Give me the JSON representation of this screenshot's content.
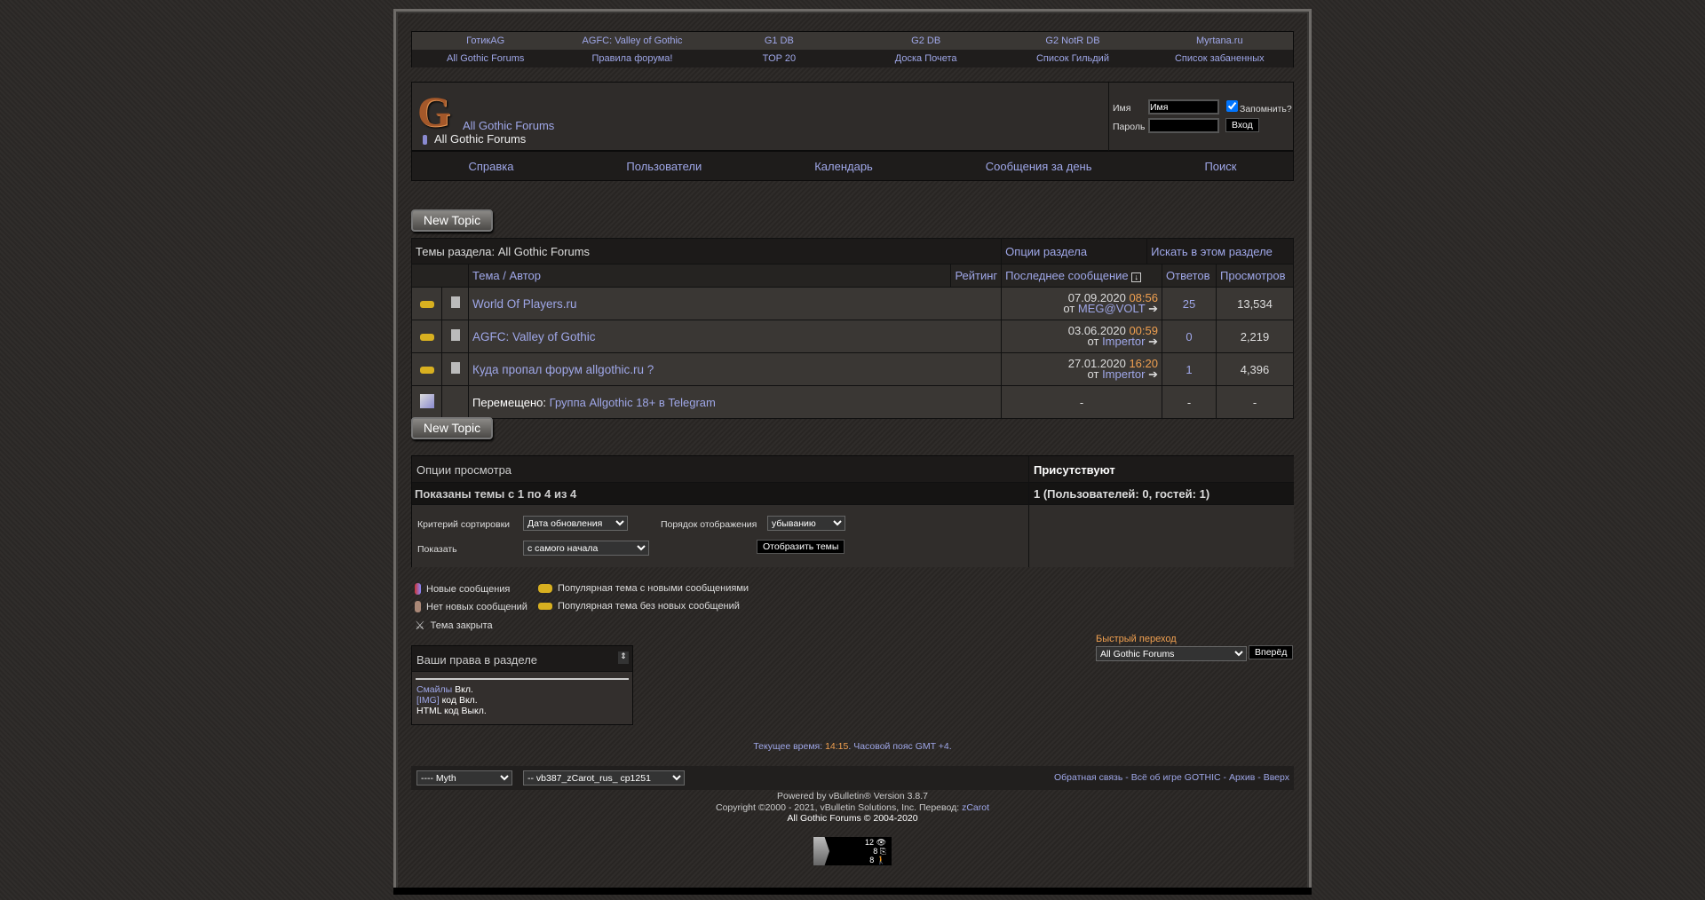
{
  "top_nav": {
    "row1": [
      "ГотикAG",
      "AGFC: Valley of Gothic",
      "G1 DB",
      "G2 DB",
      "G2 NotR DB",
      "Myrtana.ru"
    ],
    "row2": [
      "All Gothic Forums",
      "Правила форума!",
      "TOP 20",
      "Доска Почета",
      "Список Гильдий",
      "Список забаненных"
    ]
  },
  "header": {
    "logo_text": "All Gothic Forums",
    "breadcrumb": "All Gothic Forums"
  },
  "login": {
    "name_label": "Имя",
    "name_value": "Имя",
    "remember_label": "Запомнить?",
    "remember_checked": true,
    "password_label": "Пароль",
    "submit": "Вход"
  },
  "menu": [
    "Справка",
    "Пользователи",
    "Календарь",
    "Сообщения за день",
    "Поиск"
  ],
  "new_topic": "New Topic",
  "threads": {
    "title": "Темы раздела: All Gothic Forums",
    "options": "Опции раздела",
    "search": "Искать в этом разделе",
    "columns": {
      "topic": "Тема / Автор",
      "rating": "Рейтинг",
      "last_post": "Последнее сообщение",
      "replies": "Ответов",
      "views": "Просмотров"
    },
    "rows": [
      {
        "title": "World Of Players.ru",
        "date": "07.09.2020",
        "time": "08:56",
        "by": "от",
        "author": "MEG@VOLT",
        "replies": "25",
        "views": "13,534"
      },
      {
        "title": "AGFC: Valley of Gothic",
        "date": "03.06.2020",
        "time": "00:59",
        "by": "от",
        "author": "Impertor",
        "replies": "0",
        "views": "2,219"
      },
      {
        "title": "Куда пропал форум allgothic.ru ?",
        "date": "27.01.2020",
        "time": "16:20",
        "by": "от",
        "author": "Impertor",
        "replies": "1",
        "views": "4,396"
      }
    ],
    "moved": {
      "prefix": "Перемещено:",
      "title": "Группа Allgothic 18+ в Telegram",
      "last": "-",
      "replies": "-",
      "views": "-"
    }
  },
  "view_options": {
    "title": "Опции просмотра",
    "shown": "Показаны темы с 1 по 4 из 4",
    "sort_label": "Критерий сортировки",
    "sort_value": "Дата обновления",
    "order_label": "Порядок отображения",
    "order_value": "убыванию",
    "show_label": "Показать",
    "show_value": "с самого начала",
    "submit": "Отобразить темы"
  },
  "present": {
    "title": "Присутствуют",
    "count": "1 (Пользователей: 0, гостей: 1)"
  },
  "legend": {
    "new": "Новые сообщения",
    "hot_new": "Популярная тема с новыми сообщениями",
    "no_new": "Нет новых сообщений",
    "hot_no_new": "Популярная тема без новых сообщений",
    "closed": "Тема закрыта"
  },
  "rights": {
    "title": "Ваши права в разделе",
    "smilies_link": "Смайлы",
    "smilies_val": "Вкл.",
    "img_link": "[IMG]",
    "img_val": "код Вкл.",
    "html": "HTML код Выкл."
  },
  "quick_jump": {
    "label": "Быстрый переход",
    "value": "All Gothic Forums",
    "submit": "Вперёд"
  },
  "time": {
    "prefix": "Текущее время:",
    "time": "14:15",
    "suffix": ". Часовой пояс",
    "tz": "GMT +4",
    "end": "."
  },
  "footer": {
    "style": "---- Myth",
    "lang": "-- vb387_zCarot_rus_ cp1251",
    "links": [
      "Обратная связь",
      "Всё об игре GOTHIC",
      "Архив",
      "Вверх"
    ],
    "powered": "Powered by vBulletin® Version 3.8.7",
    "copyright": "Copyright ©2000 - 2021, vBulletin Solutions, Inc. Перевод:",
    "translator": "zCarot",
    "site": "All Gothic Forums © 2004-2020"
  },
  "counter": {
    "views": "12",
    "visits": "8",
    "visitors": "8"
  },
  "colors": {
    "link": "#9fa7e8",
    "time": "#f0a050",
    "background": "#2c2927"
  }
}
